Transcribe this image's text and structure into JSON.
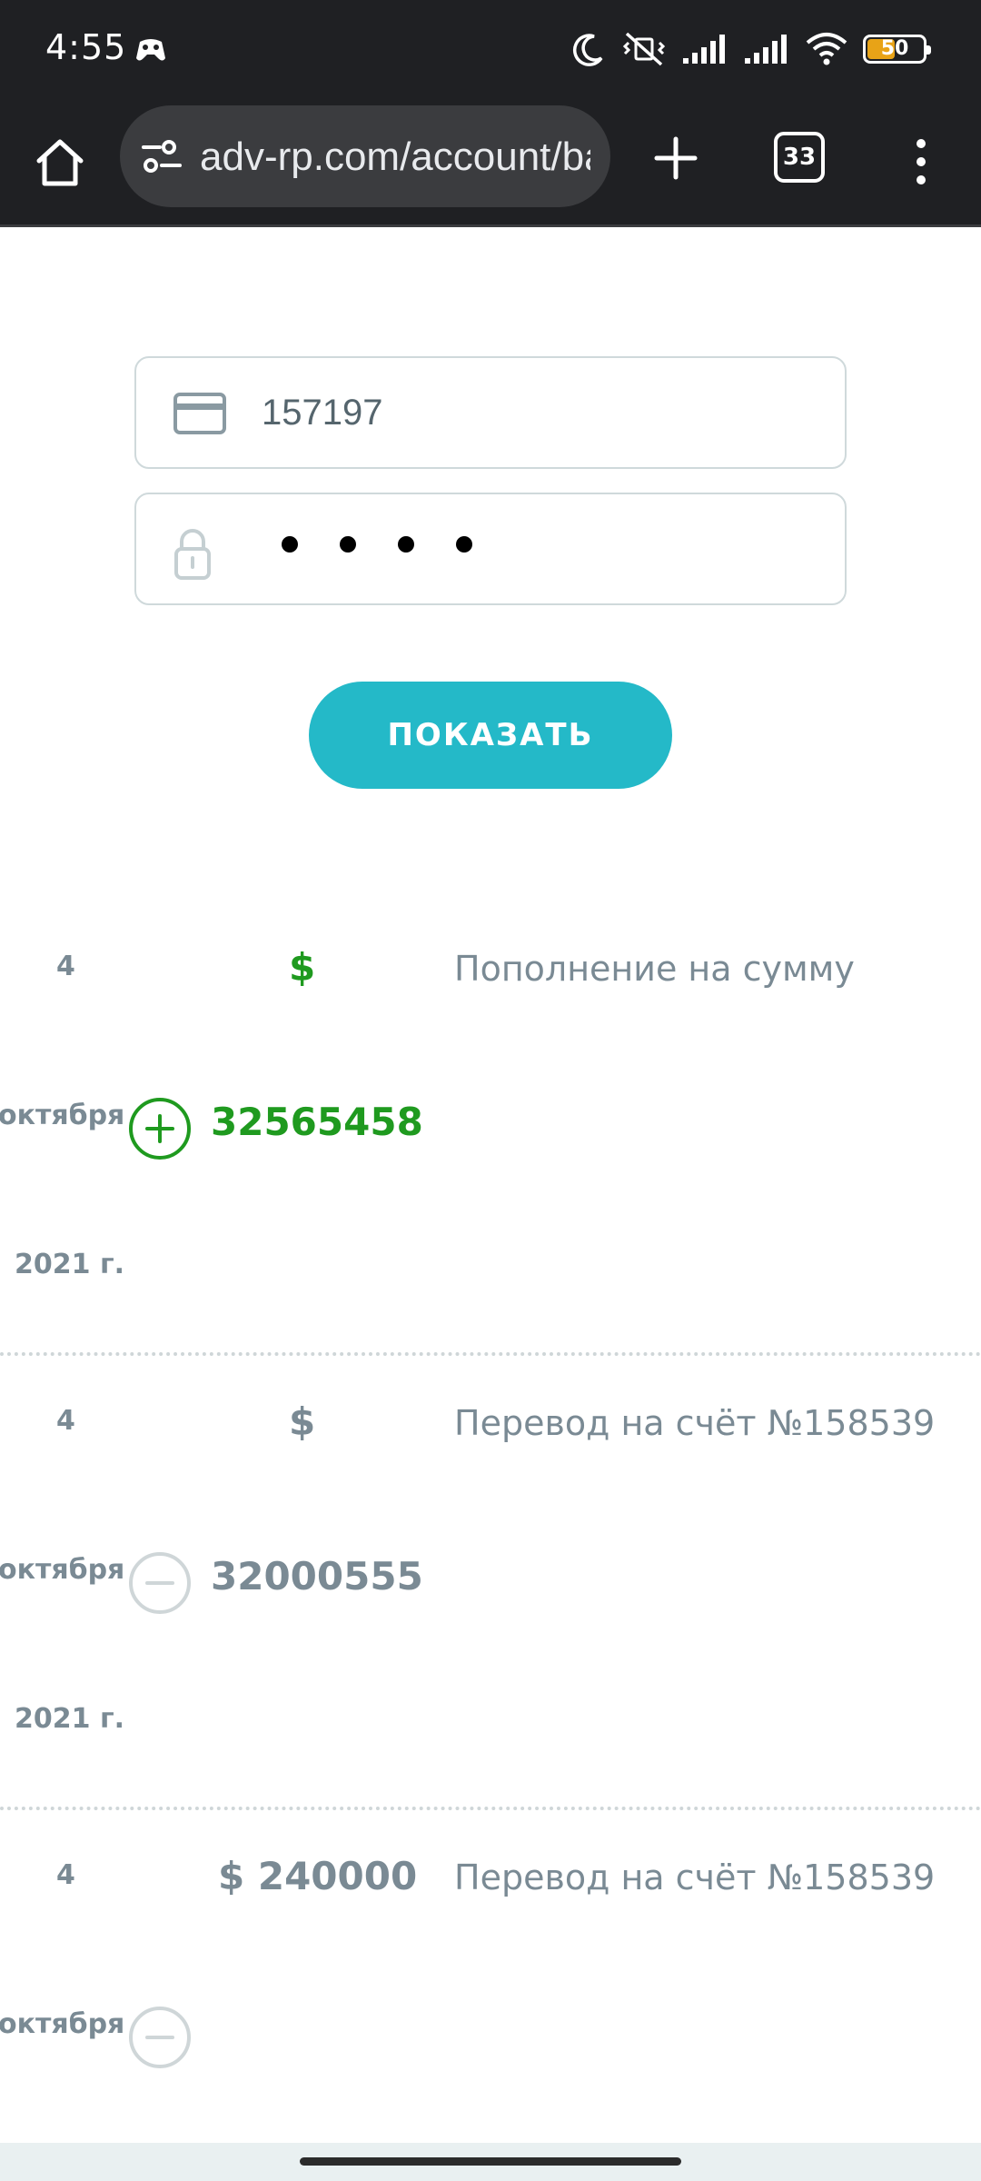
{
  "status_bar": {
    "time": "4:55",
    "battery_level": "50",
    "battery_fraction": 0.5,
    "icons": [
      "game-controller-icon",
      "moon-icon",
      "muted-vibrate-icon",
      "signal-icon",
      "signal-icon",
      "wifi-icon",
      "battery-icon"
    ]
  },
  "browser": {
    "url": "adv-rp.com/account/bank",
    "tab_count": "33",
    "icons": [
      "home-icon",
      "site-settings-icon",
      "plus-icon",
      "overflow-menu-icon"
    ]
  },
  "form": {
    "account_value": "157197",
    "account_icon": "credit-card-icon",
    "password_length": 4,
    "password_icon": "padlock-icon",
    "show_button_label": "ПОКАЗАТЬ"
  },
  "transactions": [
    {
      "day": "4",
      "month": "октября",
      "year": "2021 г.",
      "type": "income",
      "currency": "$",
      "amount": "32565458",
      "description": "Пополнение на сумму"
    },
    {
      "day": "4",
      "month": "октября",
      "year": "2021 г.",
      "type": "expense",
      "currency": "$",
      "amount": "32000555",
      "description": "Перевод на счёт №158539"
    },
    {
      "day": "4",
      "month": "октября",
      "type": "expense",
      "amount_inline": "$ 240000",
      "description": "Перевод на счёт №158539"
    }
  ],
  "colors": {
    "status_bar_bg": "#1f2023",
    "accent_button": "#24b9c8",
    "income_green": "#1f9a1f",
    "muted_text": "#7a8a94",
    "battery_fill": "#e8a317"
  }
}
